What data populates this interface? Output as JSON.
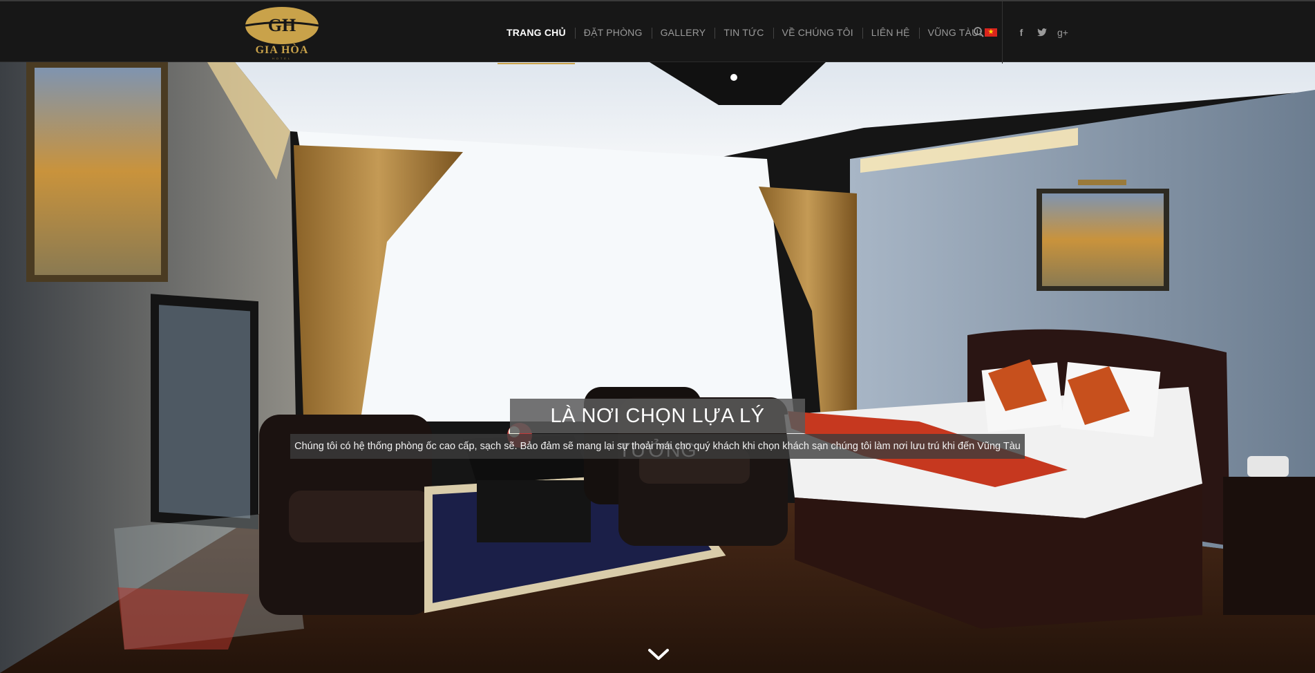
{
  "brand": {
    "name": "GIA HÒA",
    "monogram": "GH",
    "sub": "HOTEL",
    "gold": "#c9a24a"
  },
  "nav": {
    "items": [
      {
        "label": "TRANG CHỦ",
        "active": true
      },
      {
        "label": "ĐẶT PHÒNG"
      },
      {
        "label": "GALLERY"
      },
      {
        "label": "TIN TỨC"
      },
      {
        "label": "VỀ CHÚNG TÔI"
      },
      {
        "label": "LIÊN HỆ"
      },
      {
        "label": "VŨNG TÀU:"
      }
    ],
    "flag_icon": "vietnam-flag-icon",
    "search_icon": "search-icon"
  },
  "social": {
    "facebook": "f",
    "twitter": "twitter-icon",
    "googleplus": "g+"
  },
  "hero": {
    "title": "LÀ NƠI CHỌN LỰA LÝ TƯỞNG",
    "subtitle": "Chúng tôi có hệ thống phòng ốc cao cấp, sạch sẽ. Bảo đảm sẽ mang lại sự thoải mái cho quý khách khi chọn khách sạn chúng tôi làm nơi lưu trú khi đến Vũng Tàu",
    "scroll_icon": "chevron-down-icon"
  }
}
